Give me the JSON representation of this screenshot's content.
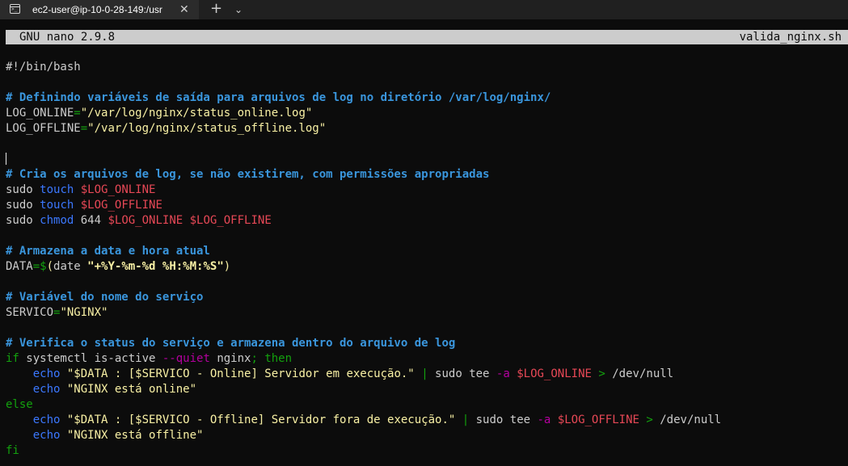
{
  "window": {
    "tab_title": "ec2-user@ip-10-0-28-149:/usr",
    "tab_close": "✕",
    "new_tab": "+",
    "dropdown": "⌄"
  },
  "nano": {
    "version": "GNU nano 2.9.8",
    "filename": "valida_nginx.sh"
  },
  "colors": {
    "comment": "#3a96dd",
    "keyword": "#3b78ff",
    "operator": "#13a10e",
    "string": "#f9f1a5",
    "variable": "#e74856",
    "option": "#b4009e",
    "plain": "#cccccc",
    "header_bg": "#cccccc"
  },
  "lines": [
    [
      {
        "t": "#!/bin/bash",
        "c": "p"
      }
    ],
    [],
    [
      {
        "t": "# Definindo variáveis de saída para arquivos de log no diretório /var/log/nginx/",
        "c": "c"
      }
    ],
    [
      {
        "t": "LOG_ONLINE",
        "c": "p"
      },
      {
        "t": "=",
        "c": "g"
      },
      {
        "t": "\"/var/log/nginx/status_online.log\"",
        "c": "y"
      }
    ],
    [
      {
        "t": "LOG_OFFLINE",
        "c": "p"
      },
      {
        "t": "=",
        "c": "g"
      },
      {
        "t": "\"/var/log/nginx/status_offline.log\"",
        "c": "y"
      }
    ],
    [],
    [],
    [
      {
        "t": "# Cria os arquivos de log, se não existirem, com permissões apropriadas",
        "c": "c"
      }
    ],
    [
      {
        "t": "sudo ",
        "c": "p"
      },
      {
        "t": "touch",
        "c": "b"
      },
      {
        "t": " ",
        "c": "p"
      },
      {
        "t": "$LOG_ONLINE",
        "c": "r"
      }
    ],
    [
      {
        "t": "sudo ",
        "c": "p"
      },
      {
        "t": "touch",
        "c": "b"
      },
      {
        "t": " ",
        "c": "p"
      },
      {
        "t": "$LOG_OFFLINE",
        "c": "r"
      }
    ],
    [
      {
        "t": "sudo ",
        "c": "p"
      },
      {
        "t": "chmod",
        "c": "b"
      },
      {
        "t": " 644 ",
        "c": "p"
      },
      {
        "t": "$LOG_ONLINE $LOG_OFFLINE",
        "c": "r"
      }
    ],
    [],
    [
      {
        "t": "# Armazena a data e hora atual",
        "c": "c"
      }
    ],
    [
      {
        "t": "DATA",
        "c": "p"
      },
      {
        "t": "=$",
        "c": "g"
      },
      {
        "t": "(",
        "c": "y"
      },
      {
        "t": "date ",
        "c": "p"
      },
      {
        "t": "\"+%Y-%m-%d %H:%M:%S\"",
        "c": "Y"
      },
      {
        "t": ")",
        "c": "y"
      }
    ],
    [],
    [
      {
        "t": "# Variável do nome do serviço",
        "c": "c"
      }
    ],
    [
      {
        "t": "SERVICO",
        "c": "p"
      },
      {
        "t": "=",
        "c": "g"
      },
      {
        "t": "\"NGINX\"",
        "c": "y"
      }
    ],
    [],
    [
      {
        "t": "# Verifica o status do serviço e armazena dentro do arquivo de log",
        "c": "c"
      }
    ],
    [
      {
        "t": "if",
        "c": "g"
      },
      {
        "t": " systemctl is-active ",
        "c": "p"
      },
      {
        "t": "--quiet",
        "c": "m"
      },
      {
        "t": " nginx",
        "c": "p"
      },
      {
        "t": "; then",
        "c": "g"
      }
    ],
    [
      {
        "t": "    ",
        "c": "p"
      },
      {
        "t": "echo",
        "c": "b"
      },
      {
        "t": " ",
        "c": "p"
      },
      {
        "t": "\"$DATA : [$SERVICO - Online] Servidor em execução.\"",
        "c": "y"
      },
      {
        "t": " ",
        "c": "p"
      },
      {
        "t": "|",
        "c": "g"
      },
      {
        "t": " sudo tee ",
        "c": "p"
      },
      {
        "t": "-a",
        "c": "m"
      },
      {
        "t": " ",
        "c": "p"
      },
      {
        "t": "$LOG_ONLINE",
        "c": "r"
      },
      {
        "t": " ",
        "c": "p"
      },
      {
        "t": ">",
        "c": "g"
      },
      {
        "t": " /dev/null",
        "c": "p"
      }
    ],
    [
      {
        "t": "    ",
        "c": "p"
      },
      {
        "t": "echo",
        "c": "b"
      },
      {
        "t": " ",
        "c": "p"
      },
      {
        "t": "\"NGINX está online\"",
        "c": "y"
      }
    ],
    [
      {
        "t": "else",
        "c": "g"
      }
    ],
    [
      {
        "t": "    ",
        "c": "p"
      },
      {
        "t": "echo",
        "c": "b"
      },
      {
        "t": " ",
        "c": "p"
      },
      {
        "t": "\"$DATA : [$SERVICO - Offline] Servidor fora de execução.\"",
        "c": "y"
      },
      {
        "t": " ",
        "c": "p"
      },
      {
        "t": "|",
        "c": "g"
      },
      {
        "t": " sudo tee ",
        "c": "p"
      },
      {
        "t": "-a",
        "c": "m"
      },
      {
        "t": " ",
        "c": "p"
      },
      {
        "t": "$LOG_OFFLINE",
        "c": "r"
      },
      {
        "t": " ",
        "c": "p"
      },
      {
        "t": ">",
        "c": "g"
      },
      {
        "t": " /dev/null",
        "c": "p"
      }
    ],
    [
      {
        "t": "    ",
        "c": "p"
      },
      {
        "t": "echo",
        "c": "b"
      },
      {
        "t": " ",
        "c": "p"
      },
      {
        "t": "\"NGINX está offline\"",
        "c": "y"
      }
    ],
    [
      {
        "t": "fi",
        "c": "g"
      }
    ]
  ]
}
